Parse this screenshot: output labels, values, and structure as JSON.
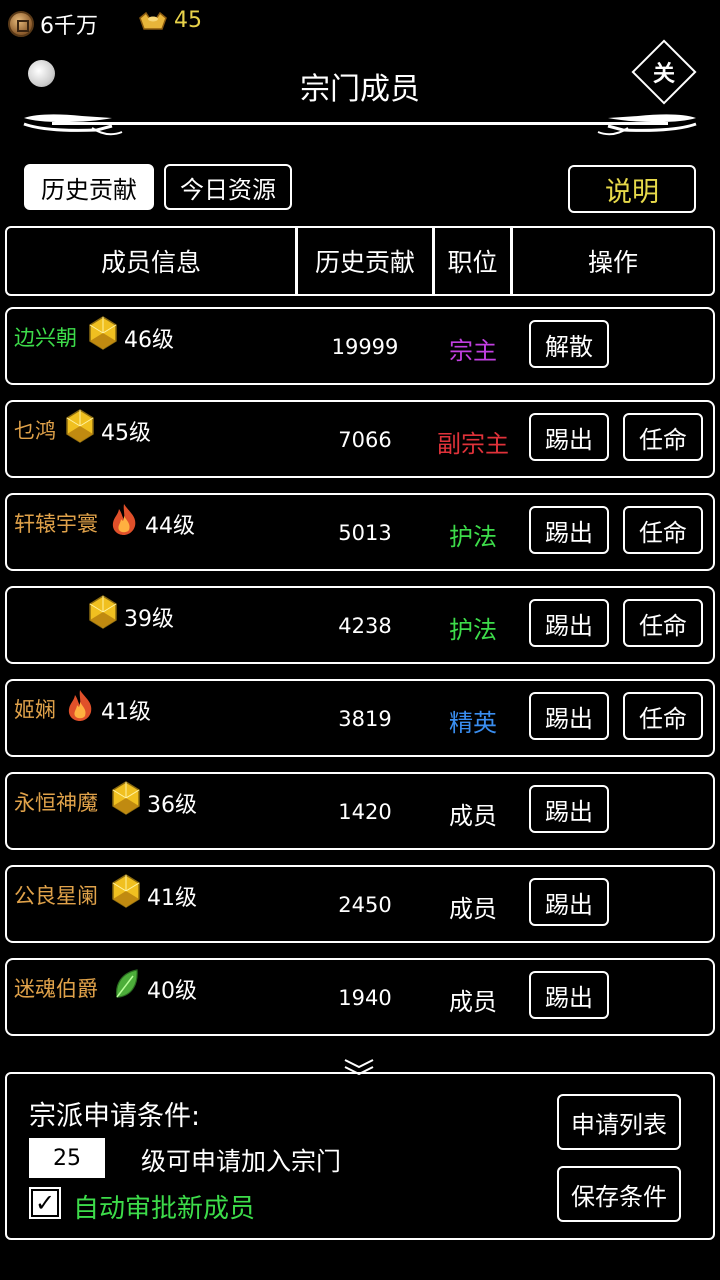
{
  "status": {
    "coins": "6千万",
    "ingots": "45",
    "coin_icon": "copper-coin-icon",
    "ingot_icon": "gold-ingot-icon"
  },
  "header": {
    "title": "宗门成员",
    "close_label": "关"
  },
  "tabs": [
    {
      "label": "历史贡献",
      "active": true
    },
    {
      "label": "今日资源",
      "active": false
    }
  ],
  "explain_label": "说明",
  "table": {
    "columns": [
      "成员信息",
      "历史贡献",
      "职位",
      "操作"
    ],
    "rows": [
      {
        "name": "边兴朝",
        "icon": "gold-gem-icon",
        "level": "46级",
        "contribution": "19999",
        "position": "宗主",
        "position_color": "#c23fe0",
        "actions": [
          "解散"
        ]
      },
      {
        "name": "乜鸿",
        "icon": "gold-gem-icon",
        "level": "45级",
        "contribution": "7066",
        "position": "副宗主",
        "position_color": "#e0323a",
        "actions": [
          "踢出",
          "任命"
        ]
      },
      {
        "name": "轩辕宇寰",
        "icon": "flame-icon",
        "level": "44级",
        "contribution": "5013",
        "position": "护法",
        "position_color": "#3ddc4a",
        "actions": [
          "踢出",
          "任命"
        ]
      },
      {
        "name": "",
        "icon": "gold-gem-icon",
        "level": "39级",
        "contribution": "4238",
        "position": "护法",
        "position_color": "#3ddc4a",
        "actions": [
          "踢出",
          "任命"
        ]
      },
      {
        "name": "姬娴",
        "icon": "flame-icon",
        "level": "41级",
        "contribution": "3819",
        "position": "精英",
        "position_color": "#3a8ef0",
        "actions": [
          "踢出",
          "任命"
        ]
      },
      {
        "name": "永恒神魔",
        "icon": "gold-gem-icon",
        "level": "36级",
        "contribution": "1420",
        "position": "成员",
        "position_color": "#ffffff",
        "actions": [
          "踢出"
        ]
      },
      {
        "name": "公良星阑",
        "icon": "gold-gem-icon",
        "level": "41级",
        "contribution": "2450",
        "position": "成员",
        "position_color": "#ffffff",
        "actions": [
          "踢出"
        ]
      },
      {
        "name": "迷魂伯爵",
        "icon": "leaf-icon",
        "level": "40级",
        "contribution": "1940",
        "position": "成员",
        "position_color": "#ffffff",
        "actions": [
          "踢出"
        ]
      }
    ]
  },
  "apply": {
    "title": "宗派申请条件:",
    "level_value": "25",
    "level_suffix": "级可申请加入宗门",
    "auto_label": "自动审批新成员",
    "auto_checked": true,
    "list_button": "申请列表",
    "save_button": "保存条件"
  }
}
